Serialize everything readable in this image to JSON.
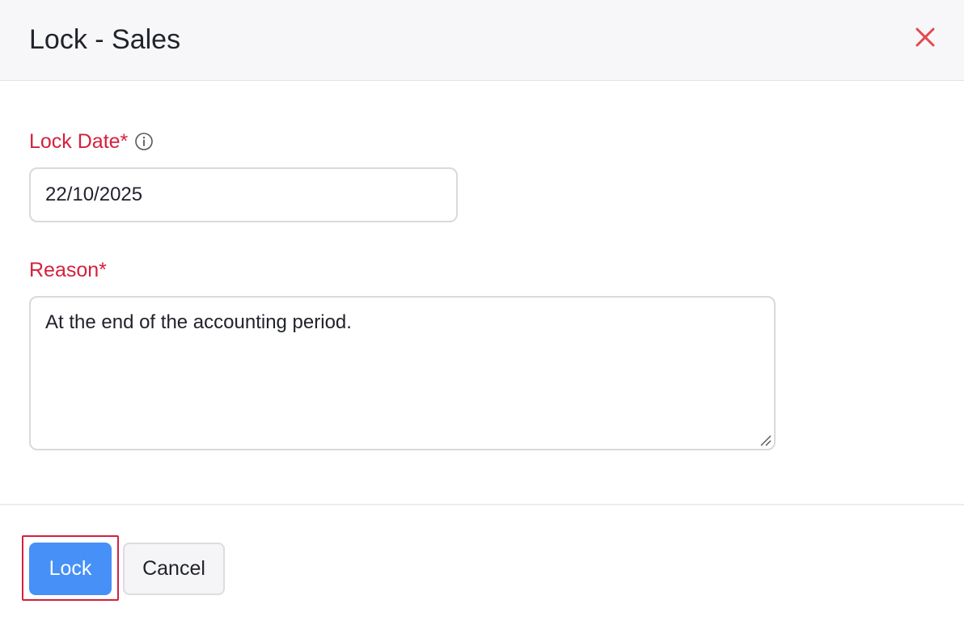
{
  "dialog": {
    "title": "Lock - Sales",
    "close_icon": "close-icon",
    "close_color": "#e5484d"
  },
  "form": {
    "lock_date": {
      "label": "Lock Date*",
      "info_icon": "info-icon",
      "value": "22/10/2025"
    },
    "reason": {
      "label": "Reason*",
      "value": "At the end of the accounting period."
    }
  },
  "footer": {
    "lock_label": "Lock",
    "cancel_label": "Cancel"
  },
  "colors": {
    "required_label": "#d6203c",
    "primary_button": "#4690f8",
    "highlight_outline": "#d6203c"
  }
}
